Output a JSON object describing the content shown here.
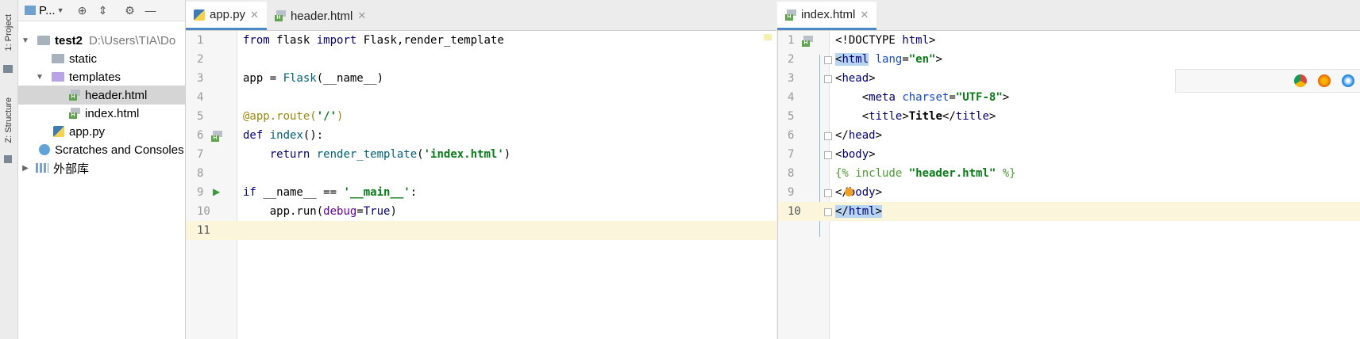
{
  "toolstrip": {
    "project_tab": "1: Project",
    "structure_tab": "Z: Structure"
  },
  "project_panel": {
    "title": "P...",
    "tree": [
      {
        "label": "test2",
        "path": "D:\\Users\\TIA\\Do",
        "type": "project",
        "expanded": true
      },
      {
        "label": "static",
        "type": "folder"
      },
      {
        "label": "templates",
        "type": "folder-templates",
        "expanded": true
      },
      {
        "label": "header.html",
        "type": "html",
        "selected": true
      },
      {
        "label": "index.html",
        "type": "html"
      },
      {
        "label": "app.py",
        "type": "python"
      },
      {
        "label": "Scratches and Consoles",
        "type": "scratches"
      },
      {
        "label": "外部库",
        "type": "library"
      }
    ]
  },
  "left_editor": {
    "tabs": [
      {
        "label": "app.py",
        "active": true
      },
      {
        "label": "header.html",
        "active": false
      }
    ],
    "current_line": 11,
    "lines": [
      {
        "n": "1",
        "parts": [
          [
            "kw",
            "from"
          ],
          [
            "",
            "flask "
          ],
          [
            "kw",
            "import"
          ],
          [
            "",
            "Flask"
          ],
          [
            "",
            "render_template"
          ]
        ],
        "text": "from flask import Flask,render_template"
      },
      {
        "n": "2",
        "text": ""
      },
      {
        "n": "3",
        "text": "app = Flask(__name__)"
      },
      {
        "n": "4",
        "text": ""
      },
      {
        "n": "5",
        "text": "@app.route('/')"
      },
      {
        "n": "6",
        "text": "def index():"
      },
      {
        "n": "7",
        "text": "    return render_template('index.html')"
      },
      {
        "n": "8",
        "text": ""
      },
      {
        "n": "9",
        "text": "if __name__ == '__main__':"
      },
      {
        "n": "10",
        "text": "    app.run(debug=True)"
      },
      {
        "n": "11",
        "text": ""
      }
    ]
  },
  "right_editor": {
    "tabs": [
      {
        "label": "index.html",
        "active": true
      }
    ],
    "current_line": 10,
    "lines": [
      {
        "n": "1",
        "text": "<!DOCTYPE html>"
      },
      {
        "n": "2",
        "text": "<html lang=\"en\">"
      },
      {
        "n": "3",
        "text": "<head>"
      },
      {
        "n": "4",
        "text": "    <meta charset=\"UTF-8\">"
      },
      {
        "n": "5",
        "text": "    <title>Title</title>"
      },
      {
        "n": "6",
        "text": "</head>"
      },
      {
        "n": "7",
        "text": "<body>"
      },
      {
        "n": "8",
        "text": "{% include \"header.html\" %}"
      },
      {
        "n": "9",
        "text": "</body>"
      },
      {
        "n": "10",
        "text": "</html>"
      }
    ]
  },
  "browser_icons": [
    "chrome-icon",
    "firefox-icon",
    "safari-icon"
  ],
  "colors": {
    "accent": "#4a88c7",
    "current_line": "#fbf5dc",
    "selection": "#b7d4f0"
  }
}
